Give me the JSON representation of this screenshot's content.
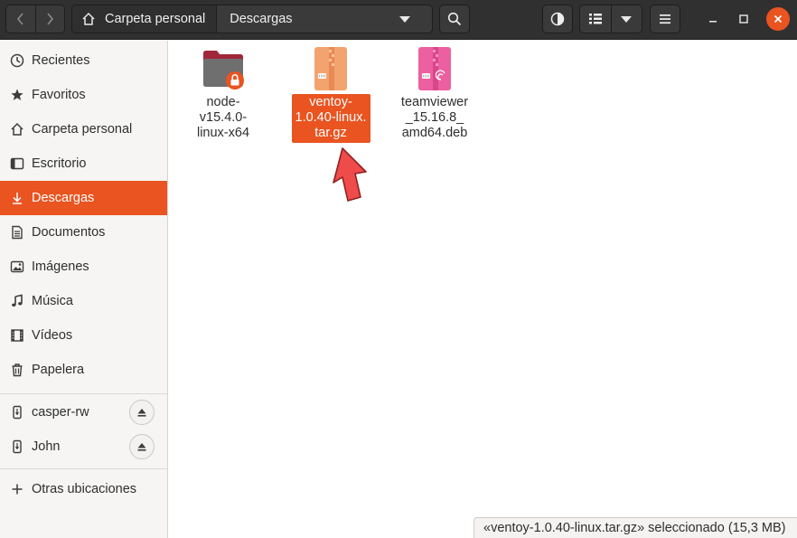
{
  "window": {
    "pathbar": {
      "home_label": "Carpeta personal",
      "current_label": "Descargas"
    }
  },
  "sidebar": {
    "items": [
      {
        "label": "Recientes",
        "icon": "clock-icon"
      },
      {
        "label": "Favoritos",
        "icon": "star-icon"
      },
      {
        "label": "Carpeta personal",
        "icon": "home-icon"
      },
      {
        "label": "Escritorio",
        "icon": "desktop-icon"
      },
      {
        "label": "Descargas",
        "icon": "download-icon",
        "active": true
      },
      {
        "label": "Documentos",
        "icon": "document-icon"
      },
      {
        "label": "Imágenes",
        "icon": "image-icon"
      },
      {
        "label": "Música",
        "icon": "music-icon"
      },
      {
        "label": "Vídeos",
        "icon": "video-icon"
      },
      {
        "label": "Papelera",
        "icon": "trash-icon"
      }
    ],
    "devices": [
      {
        "label": "casper-rw",
        "icon": "usb-drive-icon"
      },
      {
        "label": "John",
        "icon": "usb-drive-icon"
      }
    ],
    "other_locations": {
      "label": "Otras ubicaciones",
      "icon": "plus-icon"
    }
  },
  "files": [
    {
      "name": "node-v15.4.0-linux-x64",
      "display_lines": [
        "node-",
        "v15.4.0-",
        "linux-x64"
      ],
      "icon": "locked-folder-icon",
      "selected": false
    },
    {
      "name": "ventoy-1.0.40-linux.tar.gz",
      "display_lines": [
        "ventoy-",
        "1.0.40-linux.",
        "tar.gz"
      ],
      "icon": "archive-icon",
      "selected": true
    },
    {
      "name": "teamviewer_15.16.8_amd64.deb",
      "display_lines": [
        "teamviewer",
        "_15.16.8_",
        "amd64.deb"
      ],
      "icon": "debian-package-icon",
      "selected": false
    }
  ],
  "status": {
    "text": "«ventoy-1.0.40-linux.tar.gz» seleccionado  (15,3 MB)"
  },
  "colors": {
    "accent": "#e95420",
    "headerbar": "#303030",
    "sidebar": "#f6f5f4",
    "annotation_arrow": "#ef4b4b"
  }
}
